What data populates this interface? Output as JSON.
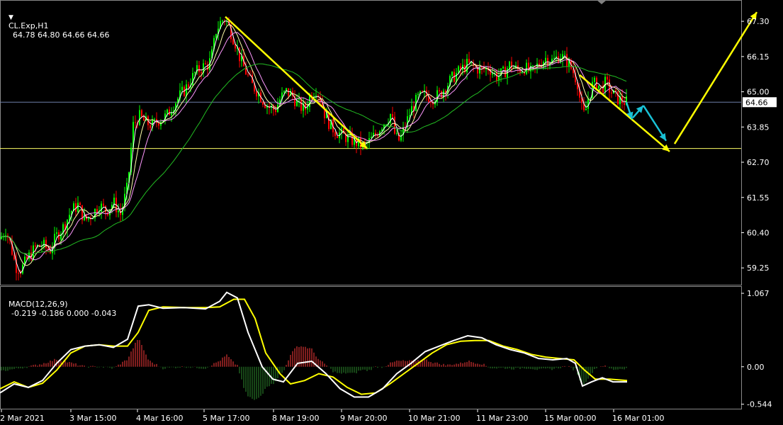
{
  "header": {
    "symbol": "CL.Exp,H1",
    "ohlc": "64.78 64.80 64.66 64.66"
  },
  "macd_header": {
    "label": "MACD(12,26,9)",
    "values": "-0.219 -0.186 0.000 -0.043"
  },
  "colors": {
    "background": "#000000",
    "bull": "#00ff00",
    "bear": "#ff0000",
    "ma_fast": "#ffffff",
    "ma_mid": "#ffffaa",
    "ma_slow": "#ff99ff",
    "ma_long": "#22bb22",
    "trend_arrow": "#ffff00",
    "forecast_arrow": "#19c2d6",
    "macd_line": "#ffffff",
    "signal_line": "#ffff00",
    "hist_pos": "#ff3b3b",
    "hist_neg": "#2e8b2e",
    "level_line": "#ffff66",
    "price_line": "#6e7ea8"
  },
  "chart_data": [
    {
      "type": "candlestick",
      "symbol": "CL.Exp",
      "timeframe": "H1",
      "ylim": [
        58.7,
        67.95
      ],
      "y_ticks": [
        "67.30",
        "66.15",
        "65.00",
        "63.85",
        "62.70",
        "61.55",
        "60.40",
        "59.25"
      ],
      "x_ticks": [
        "2 Mar 2021",
        "3 Mar 15:00",
        "4 Mar 16:00",
        "5 Mar 17:00",
        "8 Mar 19:00",
        "9 Mar 20:00",
        "10 Mar 21:00",
        "11 Mar 23:00",
        "15 Mar 00:00",
        "16 Mar 01:00"
      ],
      "current_price": "64.66",
      "support_level": 63.15,
      "path_points": [
        [
          0,
          60.2
        ],
        [
          8,
          60.5
        ],
        [
          15,
          60.0
        ],
        [
          22,
          59.3
        ],
        [
          30,
          59.2
        ],
        [
          40,
          59.6
        ],
        [
          50,
          59.9
        ],
        [
          60,
          60.0
        ],
        [
          70,
          59.8
        ],
        [
          80,
          60.3
        ],
        [
          90,
          60.6
        ],
        [
          100,
          61.1
        ],
        [
          110,
          61.3
        ],
        [
          120,
          60.8
        ],
        [
          130,
          61.0
        ],
        [
          140,
          61.3
        ],
        [
          150,
          61.1
        ],
        [
          160,
          61.4
        ],
        [
          170,
          61.0
        ],
        [
          180,
          61.9
        ],
        [
          188,
          63.9
        ],
        [
          196,
          64.2
        ],
        [
          205,
          64.0
        ],
        [
          215,
          63.9
        ],
        [
          225,
          64.1
        ],
        [
          235,
          64.2
        ],
        [
          245,
          64.6
        ],
        [
          255,
          64.9
        ],
        [
          265,
          65.2
        ],
        [
          275,
          65.6
        ],
        [
          285,
          65.8
        ],
        [
          295,
          65.9
        ],
        [
          300,
          66.3
        ],
        [
          305,
          67.0
        ],
        [
          312,
          67.3
        ],
        [
          318,
          67.4
        ],
        [
          325,
          67.0
        ],
        [
          332,
          66.6
        ],
        [
          340,
          66.0
        ],
        [
          348,
          65.6
        ],
        [
          356,
          65.2
        ],
        [
          364,
          65.0
        ],
        [
          372,
          64.7
        ],
        [
          380,
          64.5
        ],
        [
          388,
          64.4
        ],
        [
          396,
          64.8
        ],
        [
          404,
          65.0
        ],
        [
          412,
          64.9
        ],
        [
          420,
          64.6
        ],
        [
          430,
          64.4
        ],
        [
          438,
          64.9
        ],
        [
          446,
          65.1
        ],
        [
          452,
          64.8
        ],
        [
          458,
          64.3
        ],
        [
          466,
          63.9
        ],
        [
          474,
          63.7
        ],
        [
          482,
          63.6
        ],
        [
          490,
          63.5
        ],
        [
          498,
          63.4
        ],
        [
          506,
          63.3
        ],
        [
          514,
          63.2
        ],
        [
          522,
          63.4
        ],
        [
          530,
          63.6
        ],
        [
          538,
          63.9
        ],
        [
          546,
          64.1
        ],
        [
          552,
          64.3
        ],
        [
          558,
          63.5
        ],
        [
          564,
          63.4
        ],
        [
          572,
          63.9
        ],
        [
          580,
          64.4
        ],
        [
          590,
          64.8
        ],
        [
          600,
          64.9
        ],
        [
          610,
          64.8
        ],
        [
          620,
          64.9
        ],
        [
          630,
          65.2
        ],
        [
          640,
          65.5
        ],
        [
          650,
          65.7
        ],
        [
          660,
          65.9
        ],
        [
          670,
          65.8
        ],
        [
          680,
          65.7
        ],
        [
          690,
          65.8
        ],
        [
          700,
          65.5
        ],
        [
          710,
          65.6
        ],
        [
          720,
          65.9
        ],
        [
          730,
          65.7
        ],
        [
          740,
          65.8
        ],
        [
          750,
          65.6
        ],
        [
          760,
          65.9
        ],
        [
          770,
          66.1
        ],
        [
          780,
          66.0
        ],
        [
          790,
          66.2
        ],
        [
          800,
          66.0
        ],
        [
          808,
          65.7
        ],
        [
          815,
          65.3
        ],
        [
          820,
          64.5
        ],
        [
          825,
          64.2
        ],
        [
          830,
          64.8
        ],
        [
          836,
          65.2
        ],
        [
          842,
          65.3
        ],
        [
          848,
          65.1
        ],
        [
          855,
          65.3
        ],
        [
          862,
          65.0
        ],
        [
          870,
          64.8
        ],
        [
          878,
          64.7
        ],
        [
          884,
          64.66
        ]
      ],
      "trend_arrows": [
        {
          "from": [
            318,
            67.45
          ],
          "to": [
            518,
            63.15
          ]
        },
        {
          "from": [
            818,
            65.55
          ],
          "to": [
            945,
            63.05
          ]
        },
        {
          "from": [
            952,
            63.3
          ],
          "to": [
            1068,
            67.6
          ]
        }
      ],
      "forecast_arrows": [
        {
          "from": [
            884,
            64.66
          ],
          "to": [
            892,
            64.1
          ]
        },
        {
          "from": [
            893,
            64.15
          ],
          "to": [
            908,
            64.55
          ]
        },
        {
          "from": [
            908,
            64.55
          ],
          "to": [
            940,
            63.4
          ]
        }
      ]
    },
    {
      "type": "histogram+line",
      "name": "MACD(12,26,9)",
      "ylim": [
        -0.62,
        1.15
      ],
      "y_ticks": [
        "1.067",
        "0.00",
        "-0.544"
      ],
      "macd_points": [
        [
          0,
          -0.38
        ],
        [
          20,
          -0.25
        ],
        [
          40,
          -0.3
        ],
        [
          60,
          -0.2
        ],
        [
          80,
          0.05
        ],
        [
          100,
          0.25
        ],
        [
          120,
          0.3
        ],
        [
          140,
          0.32
        ],
        [
          160,
          0.28
        ],
        [
          180,
          0.4
        ],
        [
          195,
          0.88
        ],
        [
          210,
          0.9
        ],
        [
          230,
          0.85
        ],
        [
          260,
          0.86
        ],
        [
          290,
          0.84
        ],
        [
          310,
          0.95
        ],
        [
          320,
          1.08
        ],
        [
          335,
          1.0
        ],
        [
          350,
          0.5
        ],
        [
          370,
          0.0
        ],
        [
          385,
          -0.18
        ],
        [
          400,
          -0.22
        ],
        [
          420,
          0.05
        ],
        [
          440,
          0.08
        ],
        [
          460,
          -0.1
        ],
        [
          480,
          -0.32
        ],
        [
          500,
          -0.44
        ],
        [
          520,
          -0.44
        ],
        [
          540,
          -0.32
        ],
        [
          560,
          -0.1
        ],
        [
          580,
          0.05
        ],
        [
          600,
          0.22
        ],
        [
          620,
          0.3
        ],
        [
          640,
          0.38
        ],
        [
          660,
          0.45
        ],
        [
          680,
          0.42
        ],
        [
          700,
          0.32
        ],
        [
          720,
          0.25
        ],
        [
          740,
          0.2
        ],
        [
          760,
          0.12
        ],
        [
          780,
          0.1
        ],
        [
          800,
          0.12
        ],
        [
          812,
          0.05
        ],
        [
          822,
          -0.28
        ],
        [
          835,
          -0.22
        ],
        [
          850,
          -0.16
        ],
        [
          865,
          -0.22
        ],
        [
          885,
          -0.22
        ]
      ],
      "signal_points": [
        [
          0,
          -0.32
        ],
        [
          20,
          -0.22
        ],
        [
          40,
          -0.3
        ],
        [
          60,
          -0.24
        ],
        [
          80,
          -0.05
        ],
        [
          100,
          0.2
        ],
        [
          120,
          0.3
        ],
        [
          140,
          0.32
        ],
        [
          160,
          0.3
        ],
        [
          180,
          0.3
        ],
        [
          195,
          0.5
        ],
        [
          210,
          0.82
        ],
        [
          230,
          0.87
        ],
        [
          260,
          0.86
        ],
        [
          290,
          0.86
        ],
        [
          310,
          0.87
        ],
        [
          330,
          0.98
        ],
        [
          345,
          0.98
        ],
        [
          360,
          0.7
        ],
        [
          375,
          0.2
        ],
        [
          395,
          -0.1
        ],
        [
          410,
          -0.25
        ],
        [
          430,
          -0.2
        ],
        [
          450,
          -0.1
        ],
        [
          470,
          -0.15
        ],
        [
          490,
          -0.3
        ],
        [
          510,
          -0.4
        ],
        [
          530,
          -0.38
        ],
        [
          550,
          -0.25
        ],
        [
          570,
          -0.1
        ],
        [
          590,
          0.05
        ],
        [
          610,
          0.2
        ],
        [
          630,
          0.32
        ],
        [
          650,
          0.37
        ],
        [
          670,
          0.38
        ],
        [
          690,
          0.38
        ],
        [
          710,
          0.3
        ],
        [
          730,
          0.25
        ],
        [
          750,
          0.18
        ],
        [
          770,
          0.14
        ],
        [
          790,
          0.12
        ],
        [
          810,
          0.1
        ],
        [
          825,
          -0.05
        ],
        [
          840,
          -0.18
        ],
        [
          860,
          -0.18
        ],
        [
          885,
          -0.2
        ]
      ]
    }
  ]
}
